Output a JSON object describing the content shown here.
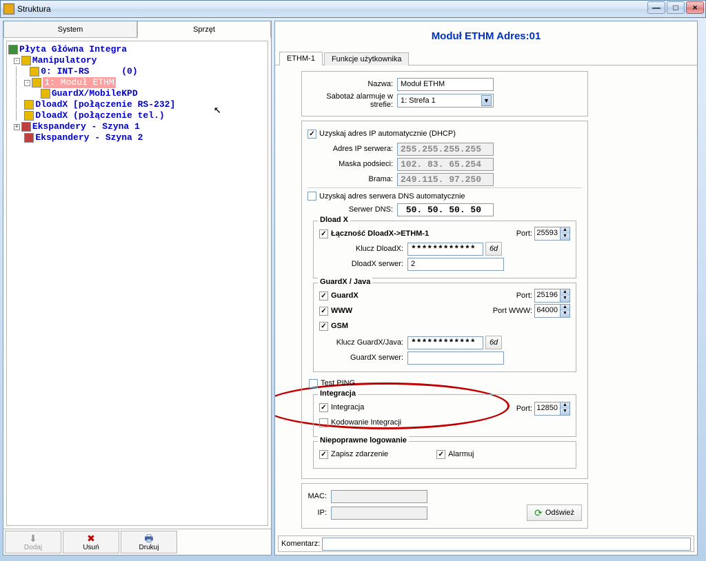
{
  "titlebar": {
    "title": "Struktura"
  },
  "left": {
    "tabs": {
      "system": "System",
      "sprzet": "Sprzęt"
    },
    "tree": {
      "root": "Płyta Główna Integra",
      "manip": "Manipulatory",
      "intrs": "0: INT-RS      (0)",
      "ethm": "1: Moduł ETHM",
      "guardx": "GuardX/MobileKPD",
      "dload232": "DloadX [połączenie RS-232]",
      "dloadtel": "DloadX (połączenie tel.)",
      "eksp1": "Ekspandery - Szyna 1",
      "eksp2": "Ekspandery - Szyna 2"
    },
    "actions": {
      "dodaj": "Dodaj",
      "usun": "Usuń",
      "drukuj": "Drukuj"
    }
  },
  "right": {
    "header": "Moduł ETHM Adres:01",
    "tabs": {
      "ethm1": "ETHM-1",
      "funkcje": "Funkcje użytkownika"
    },
    "name_label": "Nazwa:",
    "name_value": "Moduł ETHM",
    "sabotaz_label": "Sabotaż alarmuje w strefie:",
    "sabotaz_value": "1: Strefa 1",
    "dhcp_label": "Uzyskaj adres IP automatycznie (DHCP)",
    "ip_label": "Adres IP serwera:",
    "ip_value": "255.255.255.255",
    "mask_label": "Maska podsieci:",
    "mask_value": "102. 83. 65.254",
    "gate_label": "Brama:",
    "gate_value": "249.115. 97.250",
    "dns_auto_label": "Uzyskaj adres serwera DNS automatycznie",
    "dns_label": "Serwer DNS:",
    "dns_value": " 50. 50. 50. 50",
    "dloadx": {
      "title": "Dload X",
      "conn_label": "Łączność DloadX->ETHM-1",
      "port_label": "Port:",
      "port_value": "25593",
      "key_label": "Klucz DloadX:",
      "key_value": "************",
      "server_label": "DloadX serwer:",
      "server_value": "2"
    },
    "guardx": {
      "title": "GuardX / Java",
      "guardx_label": "GuardX",
      "www_label": "WWW",
      "gsm_label": "GSM",
      "port_label": "Port:",
      "port_value": "25196",
      "portwww_label": "Port WWW:",
      "portwww_value": "64000",
      "key_label": "Klucz GuardX/Java:",
      "key_value": "************",
      "server_label": "GuardX serwer:"
    },
    "testping_label": "Test PING",
    "integration": {
      "title": "Integracja",
      "int_label": "Integracja",
      "cod_label": "Kodowanie Integracji",
      "port_label": "Port:",
      "port_value": "12850"
    },
    "niepoprawne": {
      "title": "Niepoprawne logowanie",
      "zapisz_label": "Zapisz zdarzenie",
      "alarmuj_label": "Alarmuj"
    },
    "mac_label": "MAC:",
    "iplow_label": "IP:",
    "refresh_label": "Odśwież",
    "komentarz_label": "Komentarz:"
  }
}
